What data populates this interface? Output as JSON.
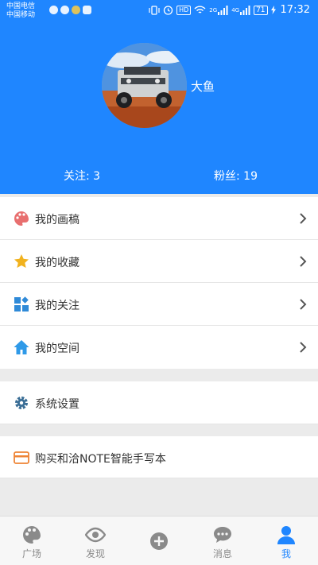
{
  "status_bar": {
    "carrier_1": "中国电信",
    "carrier_2": "中国移动",
    "battery": "71",
    "time": "17:32",
    "hd": "HD",
    "net_2g": "2G",
    "net_4g": "4G"
  },
  "profile": {
    "username": "大鱼",
    "follow_label": "关注: 3",
    "fans_label": "粉丝: 19",
    "header_color": "#1f86ff"
  },
  "menu": {
    "items": [
      {
        "label": "我的画稿",
        "icon": "palette-icon"
      },
      {
        "label": "我的收藏",
        "icon": "star-icon"
      },
      {
        "label": "我的关注",
        "icon": "grid-icon"
      },
      {
        "label": "我的空间",
        "icon": "home-icon"
      }
    ]
  },
  "settings": {
    "label": "系统设置",
    "icon": "gear-icon"
  },
  "purchase": {
    "label": "购买和洽NOTE智能手写本",
    "icon": "card-icon"
  },
  "tabbar": {
    "tabs": [
      {
        "label": "广场",
        "icon": "palette-icon"
      },
      {
        "label": "发现",
        "icon": "eye-icon"
      },
      {
        "label": "",
        "icon": "plus-icon"
      },
      {
        "label": "消息",
        "icon": "message-icon"
      },
      {
        "label": "我",
        "icon": "person-icon",
        "active": true
      }
    ]
  }
}
